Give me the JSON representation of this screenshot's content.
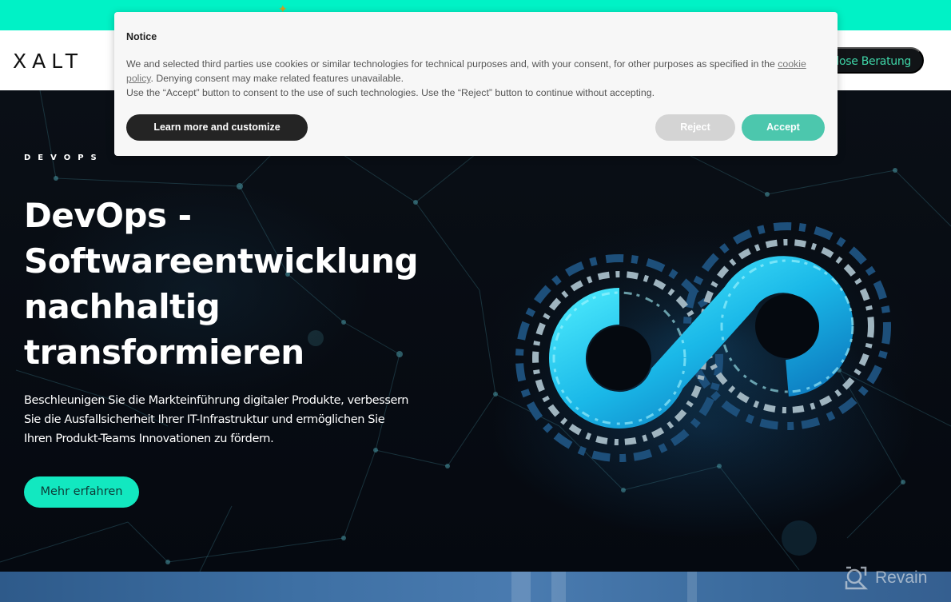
{
  "topbar": {
    "background_color": "#00f2c6"
  },
  "header": {
    "logo": "XALT",
    "cta_label": "Kostenlose Beratung",
    "cta_visible_label": "enlose Beratung"
  },
  "hero": {
    "eyebrow": "DEVOPS",
    "title_lines": [
      "DevOps -",
      "Softwareentwicklung",
      "nachhaltig",
      "transformieren"
    ],
    "text_lines": [
      "Beschleunigen Sie die Markteinführung digitaler Produkte, verbessern",
      "Sie die Ausfallsicherheit Ihrer IT-Infrastruktur und ermöglichen Sie",
      "Ihren Produkt-Teams Innovationen zu fördern."
    ],
    "cta_label": "Mehr erfahren",
    "image": "devops-infinity-icon",
    "accent_color": "#12e8c0"
  },
  "cookie_notice": {
    "title": "Notice",
    "body_part1": "We and selected third parties use cookies or similar technologies for technical purposes and, with your consent, for other purposes as specified in the ",
    "link_text": "cookie policy",
    "body_part2": ". Denying consent may make related features unavailable.",
    "body_line2": "Use the “Accept” button to consent to the use of such technologies. Use the “Reject” button to continue without accepting.",
    "buttons": {
      "learn_more": "Learn more and customize",
      "reject": "Reject",
      "accept": "Accept"
    },
    "colors": {
      "accept": "#4cc7ad",
      "reject": "#d4d4d4",
      "learn_more": "#242424"
    }
  },
  "watermark": {
    "text": "Revain"
  }
}
